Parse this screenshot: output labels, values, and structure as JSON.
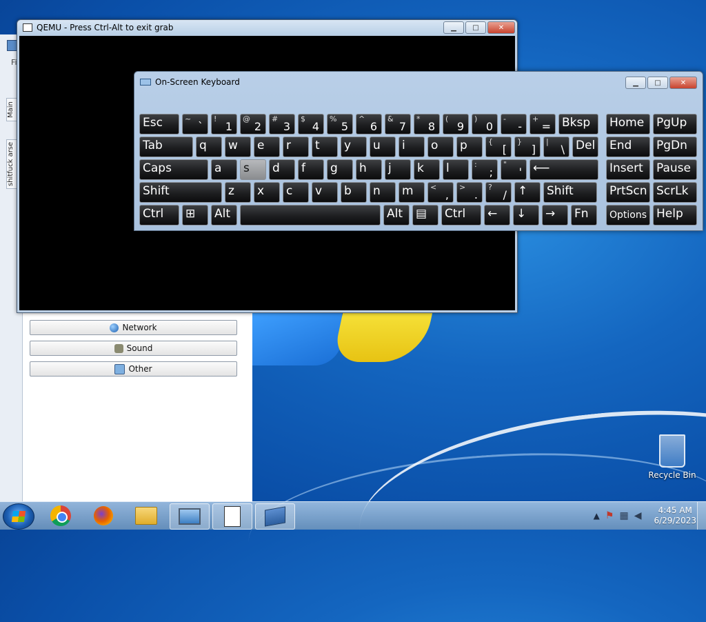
{
  "desktop": {
    "icons": [
      {
        "label": "Recycle Bin",
        "icon": "recycle-bin-icon"
      }
    ]
  },
  "bgapp": {
    "tabs": [
      "Main",
      "shitfuck arse"
    ],
    "buttons": [
      {
        "label": "Network",
        "icon": "globe-icon"
      },
      {
        "label": "Sound",
        "icon": "speaker-icon"
      },
      {
        "label": "Other",
        "icon": "monitor-icon"
      }
    ],
    "menu_fragment": "Fi"
  },
  "qemu": {
    "title": "QEMU - Press Ctrl-Alt to exit grab"
  },
  "osk": {
    "title": "On-Screen Keyboard",
    "rows": [
      [
        {
          "main": "Esc"
        },
        {
          "sm": "~",
          "big": "`"
        },
        {
          "sm": "!",
          "big": "1"
        },
        {
          "sm": "@",
          "big": "2"
        },
        {
          "sm": "#",
          "big": "3"
        },
        {
          "sm": "$",
          "big": "4"
        },
        {
          "sm": "%",
          "big": "5"
        },
        {
          "sm": "^",
          "big": "6"
        },
        {
          "sm": "&",
          "big": "7"
        },
        {
          "sm": "*",
          "big": "8"
        },
        {
          "sm": "(",
          "big": "9"
        },
        {
          "sm": ")",
          "big": "0"
        },
        {
          "sm": "-",
          "big": "-"
        },
        {
          "sm": "+",
          "big": "="
        },
        {
          "main": "Bksp"
        },
        {
          "main": "Home"
        },
        {
          "main": "PgUp"
        }
      ],
      [
        {
          "main": "Tab"
        },
        {
          "main": "q"
        },
        {
          "main": "w"
        },
        {
          "main": "e"
        },
        {
          "main": "r"
        },
        {
          "main": "t"
        },
        {
          "main": "y"
        },
        {
          "main": "u"
        },
        {
          "main": "i"
        },
        {
          "main": "o"
        },
        {
          "main": "p"
        },
        {
          "sm": "{",
          "big": "["
        },
        {
          "sm": "}",
          "big": "]"
        },
        {
          "sm": "|",
          "big": "\\"
        },
        {
          "main": "Del"
        },
        {
          "main": "End"
        },
        {
          "main": "PgDn"
        }
      ],
      [
        {
          "main": "Caps"
        },
        {
          "main": "a"
        },
        {
          "main": "s",
          "pressed": true
        },
        {
          "main": "d"
        },
        {
          "main": "f"
        },
        {
          "main": "g"
        },
        {
          "main": "h"
        },
        {
          "main": "j"
        },
        {
          "main": "k"
        },
        {
          "main": "l"
        },
        {
          "sm": ":",
          "big": ";"
        },
        {
          "sm": "\"",
          "big": "'"
        },
        {
          "main": "⟵"
        },
        {
          "main": "Insert"
        },
        {
          "main": "Pause"
        }
      ],
      [
        {
          "main": "Shift"
        },
        {
          "main": "z"
        },
        {
          "main": "x"
        },
        {
          "main": "c"
        },
        {
          "main": "v"
        },
        {
          "main": "b"
        },
        {
          "main": "n"
        },
        {
          "main": "m"
        },
        {
          "sm": "<",
          "big": ","
        },
        {
          "sm": ">",
          "big": "."
        },
        {
          "sm": "?",
          "big": "/"
        },
        {
          "main": "↑"
        },
        {
          "main": "Shift"
        },
        {
          "main": "PrtScn"
        },
        {
          "main": "ScrLk"
        }
      ],
      [
        {
          "main": "Ctrl"
        },
        {
          "main": "⊞"
        },
        {
          "main": "Alt"
        },
        {
          "main": ""
        },
        {
          "main": "Alt"
        },
        {
          "main": "▤"
        },
        {
          "main": "Ctrl"
        },
        {
          "main": "←"
        },
        {
          "main": "↓"
        },
        {
          "main": "→"
        },
        {
          "main": "Fn"
        },
        {
          "main": "Options",
          "opt": true
        },
        {
          "main": "Help"
        }
      ]
    ]
  },
  "taskbar": {
    "items": [
      {
        "name": "chrome-icon"
      },
      {
        "name": "firefox-icon"
      },
      {
        "name": "explorer-icon"
      },
      {
        "name": "monitor-app-icon",
        "active": true
      },
      {
        "name": "document-app-icon",
        "active": true
      },
      {
        "name": "keyboard-app-icon",
        "active": true
      }
    ],
    "tray": {
      "expand": "▲",
      "time": "4:45 AM",
      "date": "6/29/2023"
    }
  }
}
